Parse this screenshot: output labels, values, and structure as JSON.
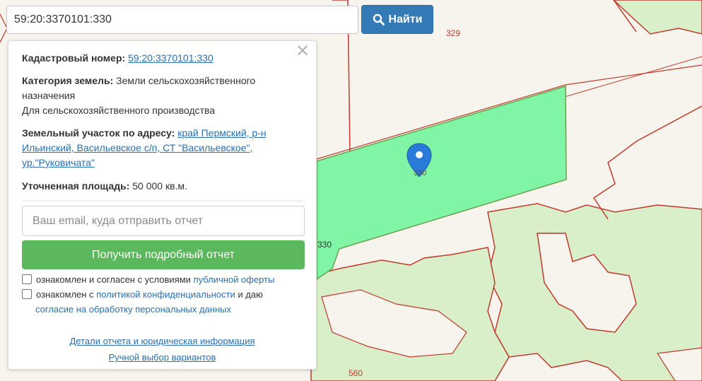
{
  "search": {
    "value": "59:20:3370101:330",
    "button_label": "Найти"
  },
  "map": {
    "parcel_labels": [
      "329",
      "330",
      "330",
      "560"
    ],
    "colors": {
      "selected_parcel": "#7ff5a5",
      "green_area": "#d8efca",
      "boundary": "#c0392b",
      "marker": "#2a7ad8"
    }
  },
  "info": {
    "cadastral_label": "Кадастровый номер:",
    "cadastral_value": "59:20:3370101:330",
    "category_label": "Категория земель:",
    "category_value": "Земли сельскохозяйственного назначения",
    "usage_value": "Для сельскохозяйственного производства",
    "address_label": "Земельный участок по адресу:",
    "address_line1": "край Пермский, р-н",
    "address_line2": "Ильинский, Васильевское с/п, СТ \"Васильевское\",",
    "address_line3": "ур.\"Руковичата\"",
    "area_label": "Уточненная площадь:",
    "area_value": "50 000 кв.м."
  },
  "form": {
    "email_placeholder": "Ваш email, куда отправить отчет",
    "report_button": "Получить подробный отчет",
    "consent1_text": "ознакомлен и согласен с условиями",
    "consent1_link": "публичной оферты",
    "consent2_text": "ознакомлен с",
    "consent2_link": "политикой конфиденциальности",
    "consent2_and": "и даю",
    "consent2_link2": "согласие на обработку персональных данных"
  },
  "footer": {
    "details_link": "Детали отчета и юридическая информация",
    "manual_link": "Ручной выбор вариантов"
  }
}
